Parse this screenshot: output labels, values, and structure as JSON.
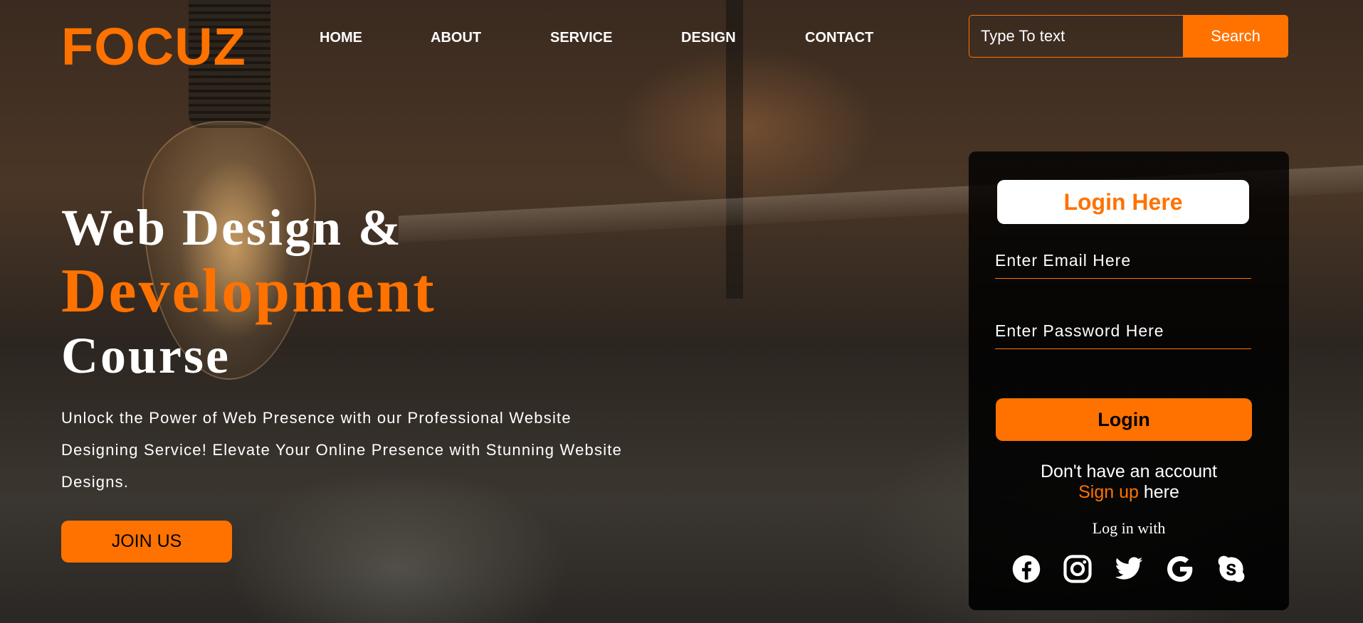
{
  "brand": {
    "logo": "FOCUZ",
    "accent_color": "#ff7200"
  },
  "nav": {
    "items": [
      "HOME",
      "ABOUT",
      "SERVICE",
      "DESIGN",
      "CONTACT"
    ]
  },
  "search": {
    "placeholder": "Type To text",
    "button_label": "Search"
  },
  "hero": {
    "line1": "Web Design &",
    "line2": "Development",
    "line3": "Course",
    "paragraph": "Unlock the Power of Web Presence with our Professional Website Designing Service! Elevate Your Online Presence with Stunning Website Designs.",
    "cta_label": "JOIN US"
  },
  "login": {
    "title": "Login Here",
    "email_placeholder": "Enter Email Here",
    "password_placeholder": "Enter Password Here",
    "button_label": "Login",
    "no_account_text": "Don't have an account",
    "signup_link": "Sign up",
    "signup_suffix": " here",
    "login_with": "Log in with",
    "social_icons": [
      "facebook-icon",
      "instagram-icon",
      "twitter-icon",
      "google-icon",
      "skype-icon"
    ]
  }
}
